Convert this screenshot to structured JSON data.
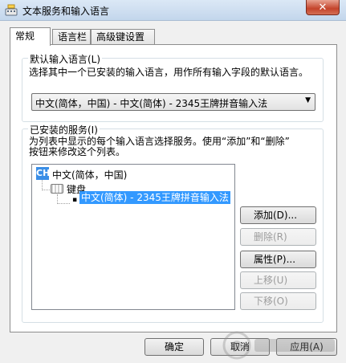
{
  "window": {
    "title": "文本服务和输入语言",
    "close_glyph": "✕"
  },
  "tabs": [
    {
      "label": "常规"
    },
    {
      "label": "语言栏"
    },
    {
      "label": "高级键设置"
    }
  ],
  "default_language": {
    "legend": "默认输入语言(L)",
    "description": "选择其中一个已安装的输入语言，用作所有输入字段的默认语言。",
    "selected": "中文(简体，中国) - 中文(简体) - 2345王牌拼音输入法"
  },
  "installed_services": {
    "legend": "已安装的服务(I)",
    "description_line1": "为列表中显示的每个输入语言选择服务。使用“添加”和“删除”",
    "description_line2": "按钮来修改这个列表。",
    "tree": {
      "language_badge": "CH",
      "language": "中文(简体，中国)",
      "category": "键盘",
      "service": "中文(简体) - 2345王牌拼音输入法"
    }
  },
  "buttons": {
    "add": "添加(D)...",
    "remove": "删除(R)",
    "properties": "属性(P)...",
    "move_up": "上移(U)",
    "move_down": "下移(O)",
    "ok": "确定",
    "cancel": "取消",
    "apply": "应用(A)"
  }
}
